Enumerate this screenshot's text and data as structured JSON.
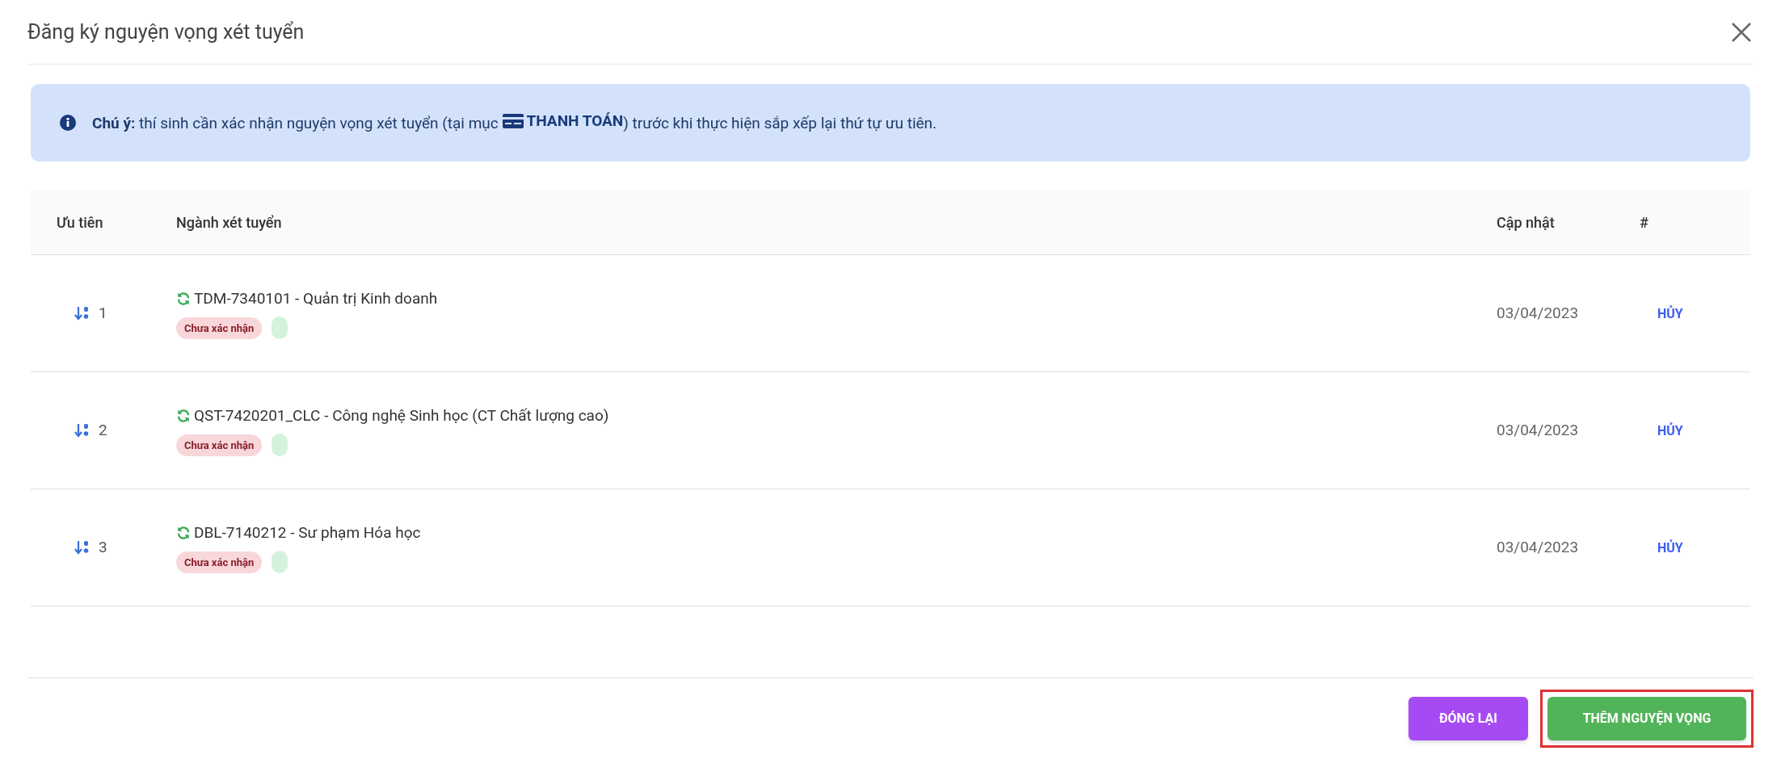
{
  "dialog": {
    "title": "Đăng ký nguyện vọng xét tuyển"
  },
  "notice": {
    "text": "**Chú ý:** thí sinh cần xác nhận nguyện vọng xét tuyển (tại mục",
    "link": "THANH TOÁN",
    "after": ") trước khi thực hiện sắp xếp lại thứ tự ưu tiên."
  },
  "table": {
    "columns": [
      "Ưu tiên",
      "Ngành xét tuyển",
      "Cập nhật",
      "#"
    ],
    "rows": [
      {
        "priority": "1",
        "program": "TDM-7340101 - Quản trị Kinh doanh",
        "status": "Chưa xác nhận",
        "updated": "03/04/2023",
        "action": "HỦY"
      },
      {
        "priority": "2",
        "program": "QST-7420201_CLC - Công nghệ Sinh học (CT Chất lượng cao)",
        "status": "Chưa xác nhận",
        "updated": "03/04/2023",
        "action": "HỦY"
      },
      {
        "priority": "3",
        "program": "DBL-7140212 - Sư phạm Hóa học",
        "status": "Chưa xác nhận",
        "updated": "03/04/2023",
        "action": "HỦY"
      }
    ]
  },
  "buttons": [
    {
      "label": "ĐÓNG LẠI",
      "kind": "close",
      "highlighted": false
    },
    {
      "label": "THÊM NGUYỆN VỌNG",
      "kind": "add",
      "highlighted": true
    }
  ]
}
